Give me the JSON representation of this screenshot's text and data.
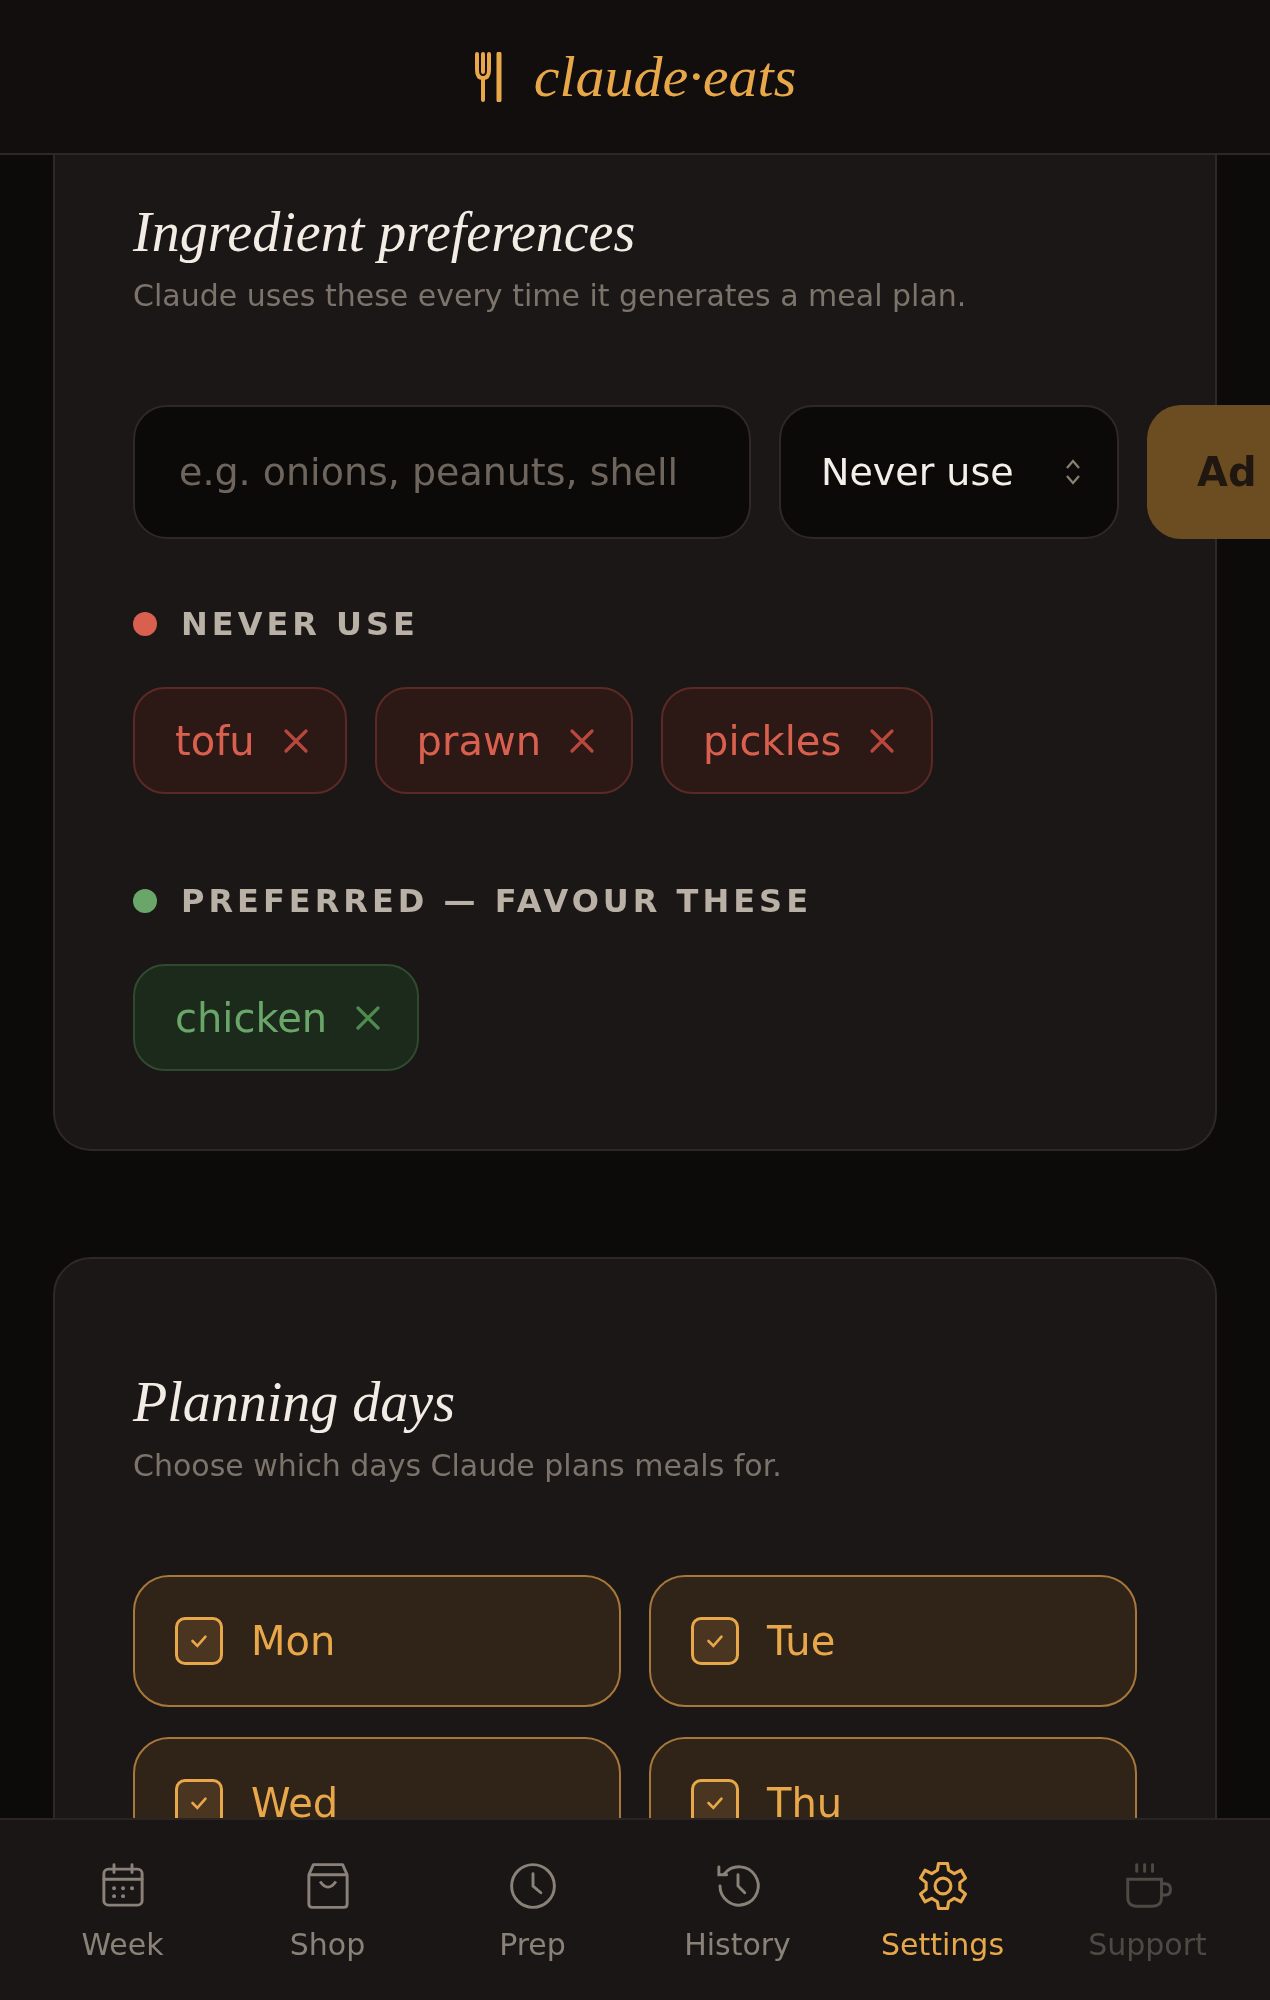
{
  "header": {
    "brand": "claude·eats"
  },
  "ingredient_preferences": {
    "title": "Ingredient preferences",
    "subtitle": "Claude uses these every time it generates a meal plan.",
    "input": {
      "placeholder": "e.g. onions, peanuts, shell"
    },
    "select": {
      "value": "Never use"
    },
    "add_button": "Ad",
    "groups": [
      {
        "label": "NEVER USE",
        "kind": "avoid",
        "color": "#d9604f",
        "items": [
          "tofu",
          "prawn",
          "pickles"
        ]
      },
      {
        "label": "PREFERRED — FAVOUR THESE",
        "kind": "prefer",
        "color": "#6aa66a",
        "items": [
          "chicken"
        ]
      }
    ]
  },
  "planning_days": {
    "title": "Planning days",
    "subtitle": "Choose which days Claude plans meals for.",
    "days": [
      {
        "label": "Mon",
        "checked": true
      },
      {
        "label": "Tue",
        "checked": true
      },
      {
        "label": "Wed",
        "checked": true
      },
      {
        "label": "Thu",
        "checked": true
      }
    ]
  },
  "nav": [
    {
      "label": "Week",
      "selected": false,
      "disabled": false
    },
    {
      "label": "Shop",
      "selected": false,
      "disabled": false
    },
    {
      "label": "Prep",
      "selected": false,
      "disabled": false
    },
    {
      "label": "History",
      "selected": false,
      "disabled": false
    },
    {
      "label": "Settings",
      "selected": true,
      "disabled": false
    },
    {
      "label": "Support",
      "selected": false,
      "disabled": true
    }
  ]
}
